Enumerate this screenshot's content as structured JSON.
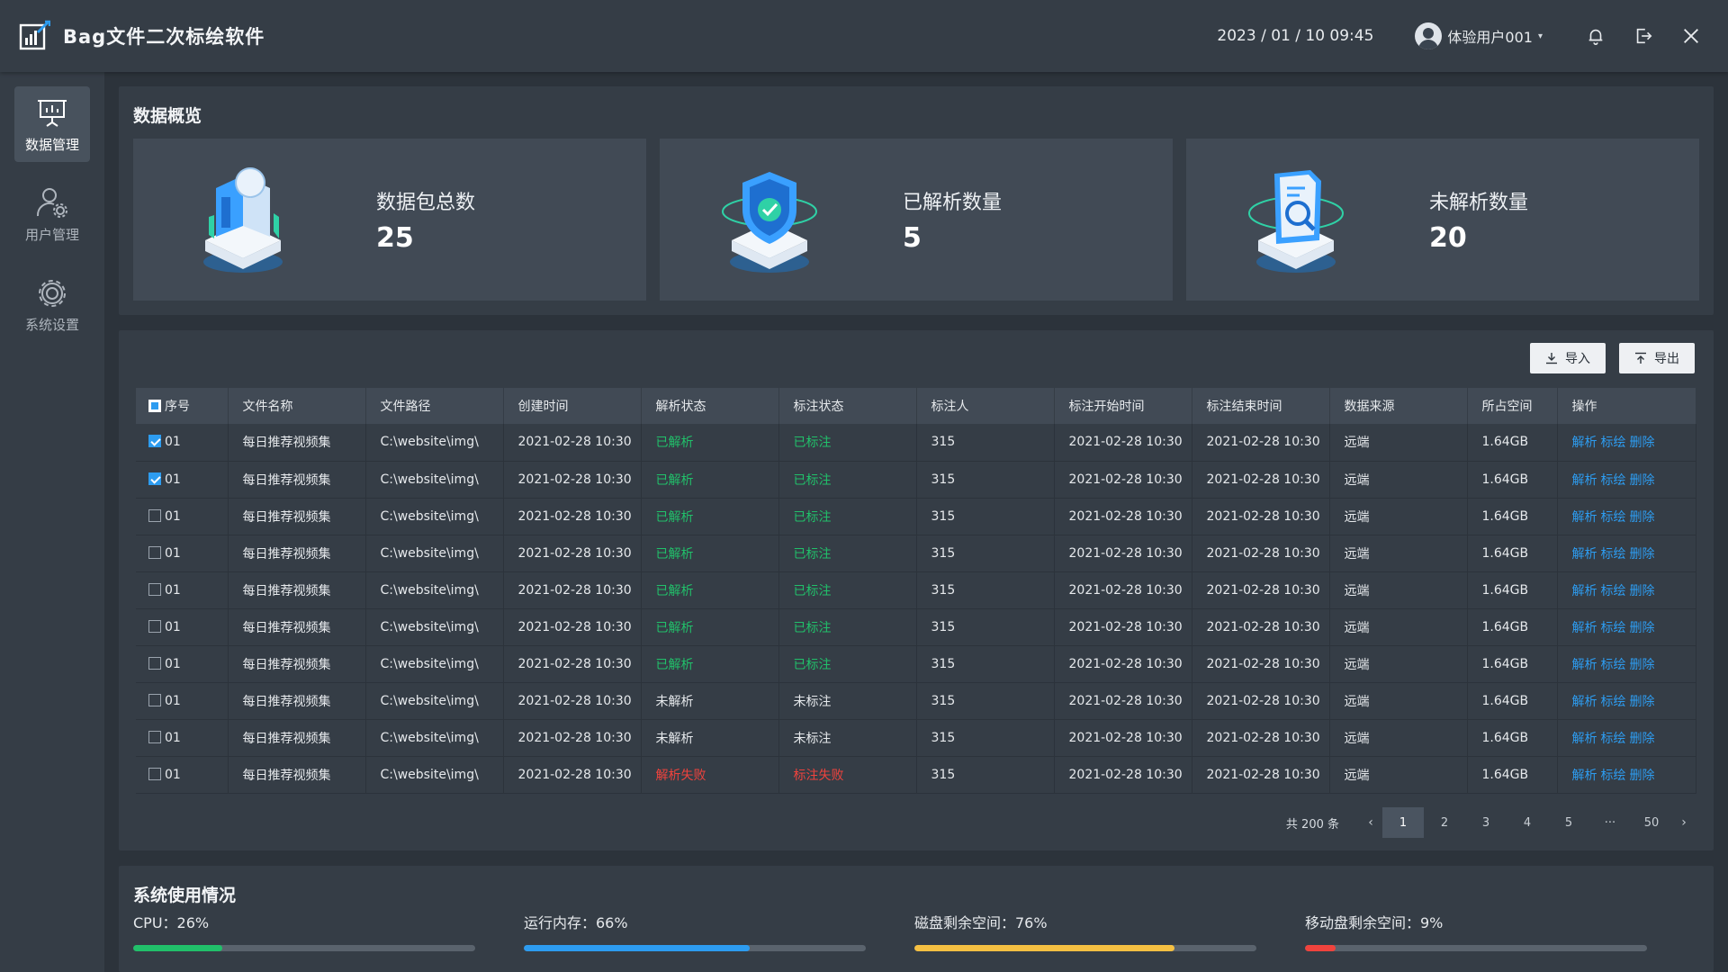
{
  "app": {
    "title": "Bag文件二次标绘软件"
  },
  "header": {
    "datetime": "2023 / 01 / 10 09:45",
    "username": "体验用户001",
    "caret": "▾"
  },
  "sidebar": {
    "items": [
      {
        "label": "数据管理",
        "icon": "presentation-icon",
        "active": true
      },
      {
        "label": "用户管理",
        "icon": "user-settings-icon",
        "active": false
      },
      {
        "label": "系统设置",
        "icon": "gear-icon",
        "active": false
      }
    ]
  },
  "overview": {
    "title": "数据概览",
    "cards": [
      {
        "label": "数据包总数",
        "value": "25",
        "icon": "data-package-illustration"
      },
      {
        "label": "已解析数量",
        "value": "5",
        "icon": "shield-check-illustration"
      },
      {
        "label": "未解析数量",
        "value": "20",
        "icon": "document-search-illustration"
      }
    ]
  },
  "toolbar": {
    "import_label": "导入",
    "export_label": "导出"
  },
  "table": {
    "columns": [
      "序号",
      "文件名称",
      "文件路径",
      "创建时间",
      "解析状态",
      "标注状态",
      "标注人",
      "标注开始时间",
      "标注结束时间",
      "数据来源",
      "所占空间",
      "操作"
    ],
    "actions": [
      "解析",
      "标绘",
      "删除"
    ],
    "rows": [
      {
        "checked": true,
        "seq": "01",
        "name": "每日推荐视频集",
        "path": "C:\\website\\img\\",
        "created": "2021-02-28 10:30",
        "parse": "已解析",
        "parse_status": "ok",
        "mark": "已标注",
        "mark_status": "ok",
        "marker": "315",
        "start": "2021-02-28 10:30",
        "end": "2021-02-28 10:30",
        "source": "远端",
        "size": "1.64GB"
      },
      {
        "checked": true,
        "seq": "01",
        "name": "每日推荐视频集",
        "path": "C:\\website\\img\\",
        "created": "2021-02-28 10:30",
        "parse": "已解析",
        "parse_status": "ok",
        "mark": "已标注",
        "mark_status": "ok",
        "marker": "315",
        "start": "2021-02-28 10:30",
        "end": "2021-02-28 10:30",
        "source": "远端",
        "size": "1.64GB"
      },
      {
        "checked": false,
        "seq": "01",
        "name": "每日推荐视频集",
        "path": "C:\\website\\img\\",
        "created": "2021-02-28 10:30",
        "parse": "已解析",
        "parse_status": "ok",
        "mark": "已标注",
        "mark_status": "ok",
        "marker": "315",
        "start": "2021-02-28 10:30",
        "end": "2021-02-28 10:30",
        "source": "远端",
        "size": "1.64GB"
      },
      {
        "checked": false,
        "seq": "01",
        "name": "每日推荐视频集",
        "path": "C:\\website\\img\\",
        "created": "2021-02-28 10:30",
        "parse": "已解析",
        "parse_status": "ok",
        "mark": "已标注",
        "mark_status": "ok",
        "marker": "315",
        "start": "2021-02-28 10:30",
        "end": "2021-02-28 10:30",
        "source": "远端",
        "size": "1.64GB"
      },
      {
        "checked": false,
        "seq": "01",
        "name": "每日推荐视频集",
        "path": "C:\\website\\img\\",
        "created": "2021-02-28 10:30",
        "parse": "已解析",
        "parse_status": "ok",
        "mark": "已标注",
        "mark_status": "ok",
        "marker": "315",
        "start": "2021-02-28 10:30",
        "end": "2021-02-28 10:30",
        "source": "远端",
        "size": "1.64GB"
      },
      {
        "checked": false,
        "seq": "01",
        "name": "每日推荐视频集",
        "path": "C:\\website\\img\\",
        "created": "2021-02-28 10:30",
        "parse": "已解析",
        "parse_status": "ok",
        "mark": "已标注",
        "mark_status": "ok",
        "marker": "315",
        "start": "2021-02-28 10:30",
        "end": "2021-02-28 10:30",
        "source": "远端",
        "size": "1.64GB"
      },
      {
        "checked": false,
        "seq": "01",
        "name": "每日推荐视频集",
        "path": "C:\\website\\img\\",
        "created": "2021-02-28 10:30",
        "parse": "已解析",
        "parse_status": "ok",
        "mark": "已标注",
        "mark_status": "ok",
        "marker": "315",
        "start": "2021-02-28 10:30",
        "end": "2021-02-28 10:30",
        "source": "远端",
        "size": "1.64GB"
      },
      {
        "checked": false,
        "seq": "01",
        "name": "每日推荐视频集",
        "path": "C:\\website\\img\\",
        "created": "2021-02-28 10:30",
        "parse": "未解析",
        "parse_status": "none",
        "mark": "未标注",
        "mark_status": "none",
        "marker": "315",
        "start": "2021-02-28 10:30",
        "end": "2021-02-28 10:30",
        "source": "远端",
        "size": "1.64GB"
      },
      {
        "checked": false,
        "seq": "01",
        "name": "每日推荐视频集",
        "path": "C:\\website\\img\\",
        "created": "2021-02-28 10:30",
        "parse": "未解析",
        "parse_status": "none",
        "mark": "未标注",
        "mark_status": "none",
        "marker": "315",
        "start": "2021-02-28 10:30",
        "end": "2021-02-28 10:30",
        "source": "远端",
        "size": "1.64GB"
      },
      {
        "checked": false,
        "seq": "01",
        "name": "每日推荐视频集",
        "path": "C:\\website\\img\\",
        "created": "2021-02-28 10:30",
        "parse": "解析失败",
        "parse_status": "fail",
        "mark": "标注失败",
        "mark_status": "fail",
        "marker": "315",
        "start": "2021-02-28 10:30",
        "end": "2021-02-28 10:30",
        "source": "远端",
        "size": "1.64GB"
      }
    ]
  },
  "pagination": {
    "total": "共 200 条",
    "prev": "‹",
    "next": "›",
    "pages": [
      "1",
      "2",
      "3",
      "4",
      "5",
      "···",
      "50"
    ],
    "current": "1"
  },
  "system": {
    "title": "系统使用情况",
    "meters": [
      {
        "label": "CPU：26%",
        "percent": 26,
        "color": "#21c06a"
      },
      {
        "label": "运行内存：66%",
        "percent": 66,
        "color": "#2d9cf0"
      },
      {
        "label": "磁盘剩余空间：76%",
        "percent": 76,
        "color": "#f5c042"
      },
      {
        "label": "移动盘剩余空间：9%",
        "percent": 9,
        "color": "#f0433d"
      }
    ]
  },
  "colors": {
    "background": "#2c333b",
    "panel": "#353d46",
    "card": "#414a55",
    "accent": "#2d9cf0",
    "success": "#21c06a",
    "danger": "#f0433d"
  }
}
